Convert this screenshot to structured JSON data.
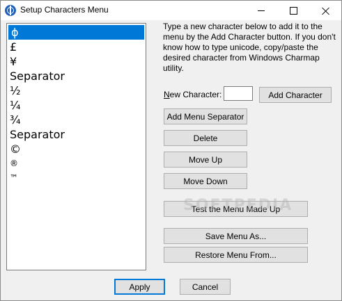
{
  "window": {
    "title": "Setup Characters Menu",
    "accent_color": "#0078d7"
  },
  "list": {
    "items": [
      {
        "label": "ϕ",
        "selected": true
      },
      {
        "label": "£"
      },
      {
        "label": "¥"
      },
      {
        "label": "Separator"
      },
      {
        "label": "½"
      },
      {
        "label": "¼"
      },
      {
        "label": "¾"
      },
      {
        "label": "Separator"
      },
      {
        "label": "©"
      },
      {
        "label": "®"
      },
      {
        "label": "™"
      }
    ]
  },
  "instructions": "Type a new character below to add it to the menu by the Add Character button. If you don't know how to type unicode, copy/paste the desired character from Windows Charmap utility.",
  "new_character": {
    "label_prefix": "N",
    "label_rest": "ew Character:",
    "value": ""
  },
  "buttons": {
    "add_character": "Add Character",
    "add_separator": "Add Menu Separator",
    "delete": "Delete",
    "move_up": "Move Up",
    "move_down": "Move Down",
    "test_menu": "Test the Menu Made Up",
    "save_menu": "Save Menu As...",
    "restore_menu": "Restore Menu From...",
    "apply": "Apply",
    "cancel": "Cancel"
  },
  "watermark": "SOFTPEDIA"
}
